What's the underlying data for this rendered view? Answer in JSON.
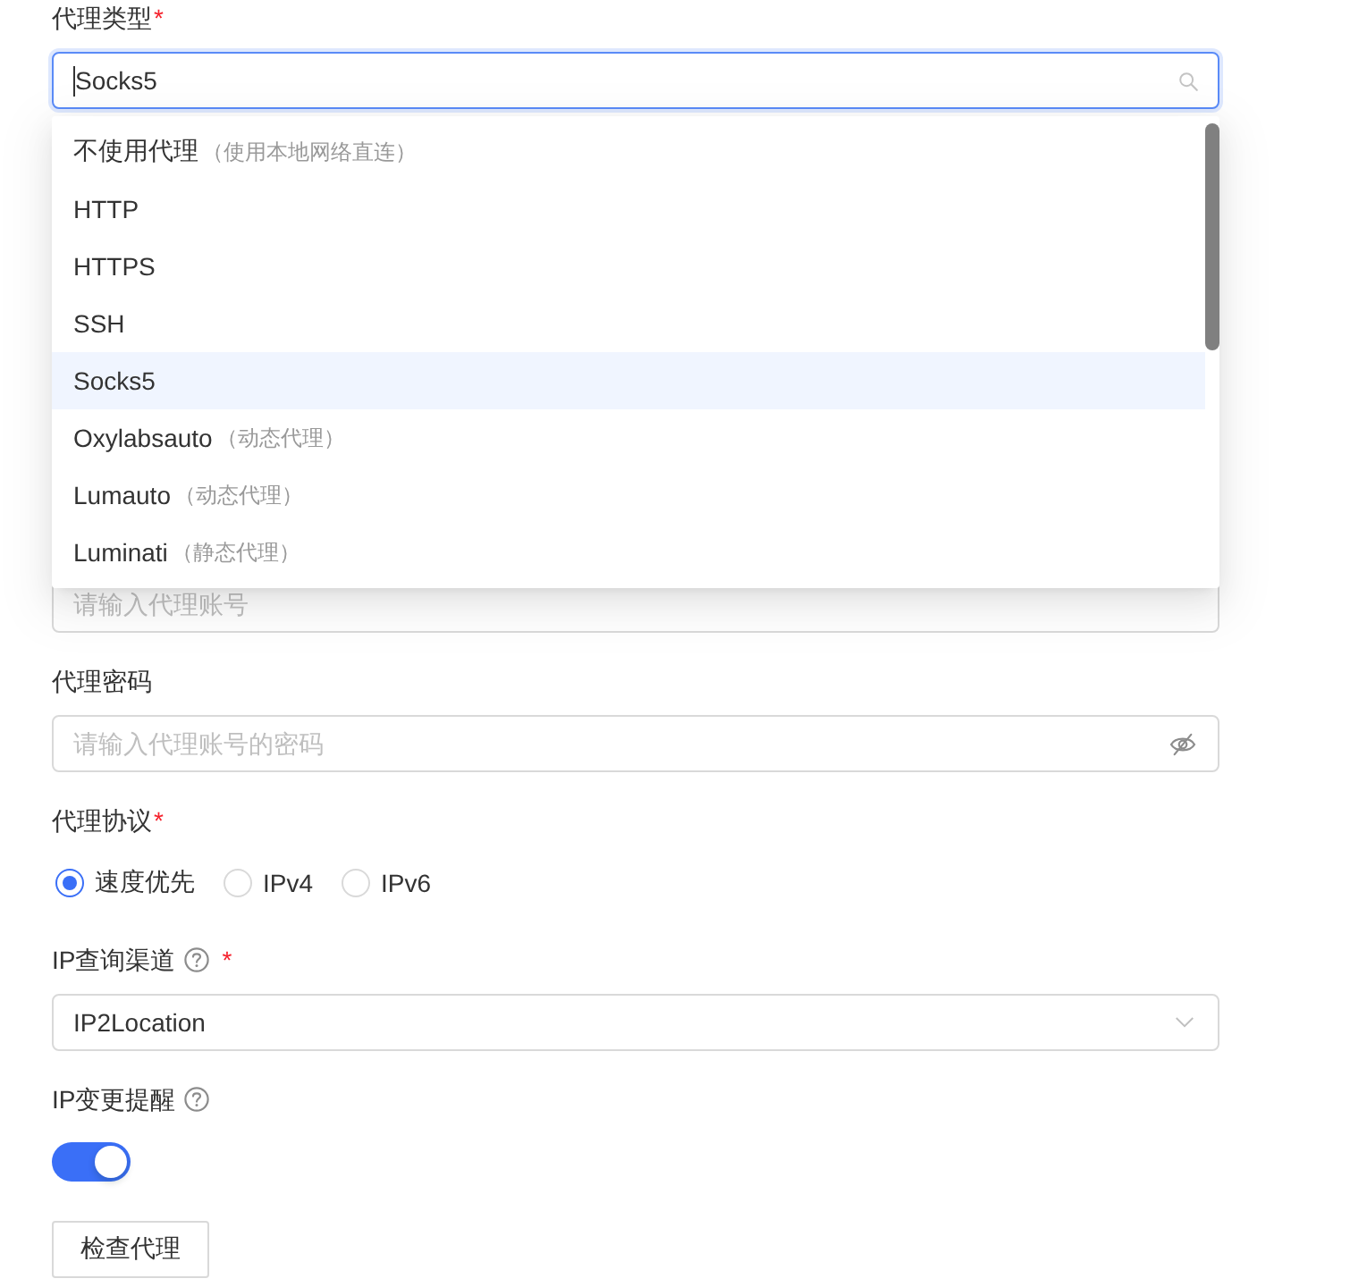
{
  "proxy_type": {
    "label": "代理类型",
    "required_mark": "*",
    "value": "Socks5",
    "focused": true,
    "expanded": true,
    "options": [
      {
        "label": "不使用代理",
        "hint": "（使用本地网络直连）",
        "selected": false
      },
      {
        "label": "HTTP",
        "selected": false
      },
      {
        "label": "HTTPS",
        "selected": false
      },
      {
        "label": "SSH",
        "selected": false
      },
      {
        "label": "Socks5",
        "selected": true
      },
      {
        "label": "Oxylabsauto",
        "hint": "（动态代理）",
        "selected": false
      },
      {
        "label": "Lumauto",
        "hint": "（动态代理）",
        "selected": false
      },
      {
        "label": "Luminati",
        "hint": "（静态代理）",
        "selected": false
      }
    ]
  },
  "account": {
    "placeholder": "请输入代理账号"
  },
  "password": {
    "label": "代理密码",
    "placeholder": "请输入代理账号的密码"
  },
  "protocol": {
    "label": "代理协议",
    "required_mark": "*",
    "options": [
      {
        "label": "速度优先",
        "selected": true
      },
      {
        "label": "IPv4",
        "selected": false
      },
      {
        "label": "IPv6",
        "selected": false
      }
    ]
  },
  "ip_channel": {
    "label": "IP查询渠道",
    "help": true,
    "required_mark": "*",
    "value": "IP2Location"
  },
  "ip_change_alert": {
    "label": "IP变更提醒",
    "help": true,
    "on": true
  },
  "check_button": {
    "label": "检查代理"
  }
}
